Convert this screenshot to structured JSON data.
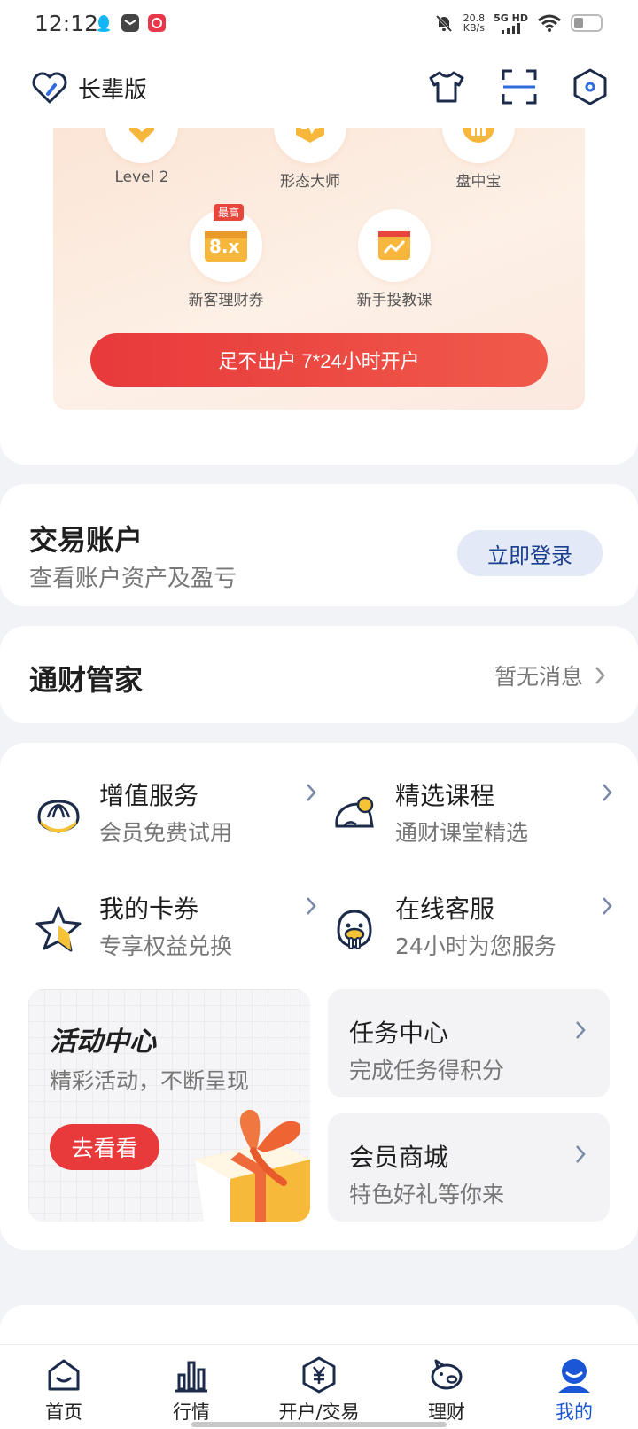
{
  "status_bar": {
    "time": "12:12",
    "net_speed_value": "20.8",
    "net_speed_unit": "KB/s",
    "net_type": "5G HD"
  },
  "header": {
    "elder_mode_label": "长辈版"
  },
  "promo": {
    "features": [
      {
        "label": "Level 2"
      },
      {
        "label": "形态大师"
      },
      {
        "label": "盘中宝"
      },
      {
        "label": "新客理财券",
        "badge": "最高",
        "icon_text": "8.x"
      },
      {
        "label": "新手投教课"
      }
    ],
    "open_account_button": "足不出户 7*24小时开户"
  },
  "account": {
    "title": "交易账户",
    "subtitle": "查看账户资产及盈亏",
    "login_button": "立即登录"
  },
  "butler": {
    "title": "通财管家",
    "status": "暂无消息"
  },
  "services": [
    {
      "title": "增值服务",
      "subtitle": "会员免费试用"
    },
    {
      "title": "精选课程",
      "subtitle": "通财课堂精选"
    },
    {
      "title": "我的卡券",
      "subtitle": "专享权益兑换"
    },
    {
      "title": "在线客服",
      "subtitle": "24小时为您服务"
    }
  ],
  "activity": {
    "title": "活动中心",
    "subtitle": "精彩活动，不断呈现",
    "button": "去看看"
  },
  "tasks": {
    "title": "任务中心",
    "subtitle": "完成任务得积分"
  },
  "mall": {
    "title": "会员商城",
    "subtitle": "特色好礼等你来"
  },
  "tabbar": {
    "tabs": [
      {
        "label": "首页"
      },
      {
        "label": "行情"
      },
      {
        "label": "开户/交易"
      },
      {
        "label": "理财"
      },
      {
        "label": "我的"
      }
    ]
  },
  "colors": {
    "accent_red": "#e8393b",
    "accent_blue": "#1a56d6",
    "login_button_bg": "#e3e9f6",
    "icon_yellow": "#f6c236"
  }
}
